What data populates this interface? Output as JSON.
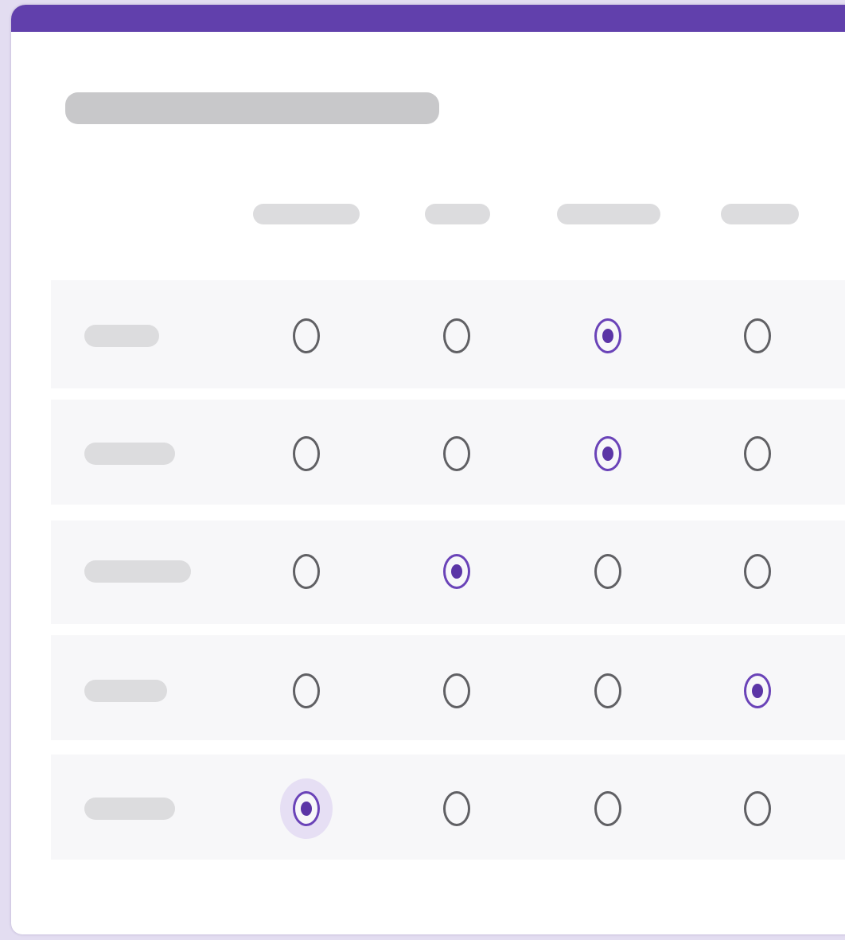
{
  "form": {
    "accent_color": "#6140ac",
    "question_title": "",
    "columns": [
      "",
      "",
      "",
      ""
    ],
    "rows": [
      {
        "label": "",
        "selected_column": 3
      },
      {
        "label": "",
        "selected_column": 3
      },
      {
        "label": "",
        "selected_column": 2
      },
      {
        "label": "",
        "selected_column": 4
      },
      {
        "label": "",
        "selected_column": 1
      }
    ],
    "focused_row": 5
  }
}
